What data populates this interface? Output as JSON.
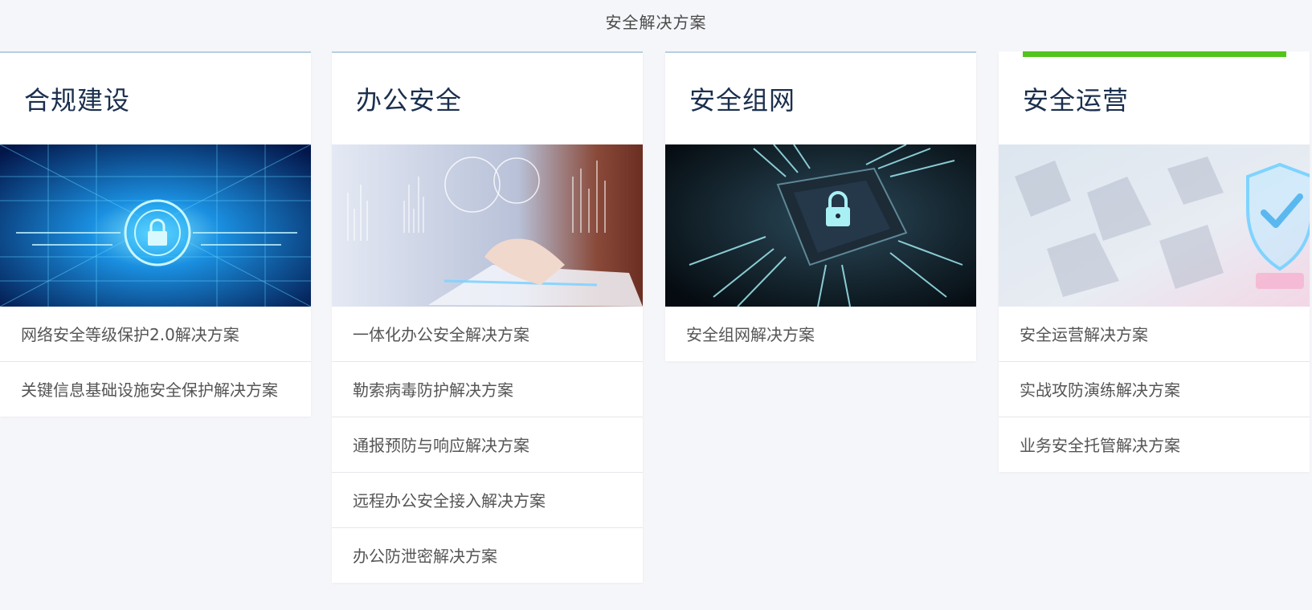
{
  "section_title": "安全解决方案",
  "cards": [
    {
      "title": "合规建设",
      "image": "network-security-image",
      "items": [
        "网络安全等级保护2.0解决方案",
        "关键信息基础设施安全保护解决方案"
      ]
    },
    {
      "title": "办公安全",
      "image": "office-security-image",
      "items": [
        "一体化办公安全解决方案",
        "勒索病毒防护解决方案",
        "通报预防与响应解决方案",
        "远程办公安全接入解决方案",
        "办公防泄密解决方案"
      ]
    },
    {
      "title": "安全组网",
      "image": "chip-lock-image",
      "items": [
        "安全组网解决方案"
      ]
    },
    {
      "title": "安全运营",
      "image": "shield-check-image",
      "items": [
        "安全运营解决方案",
        "实战攻防演练解决方案",
        "业务安全托管解决方案"
      ]
    }
  ],
  "colors": {
    "background": "#f5f6f9",
    "card_title": "#1b2f4e",
    "active_accent": "#52c41a"
  }
}
